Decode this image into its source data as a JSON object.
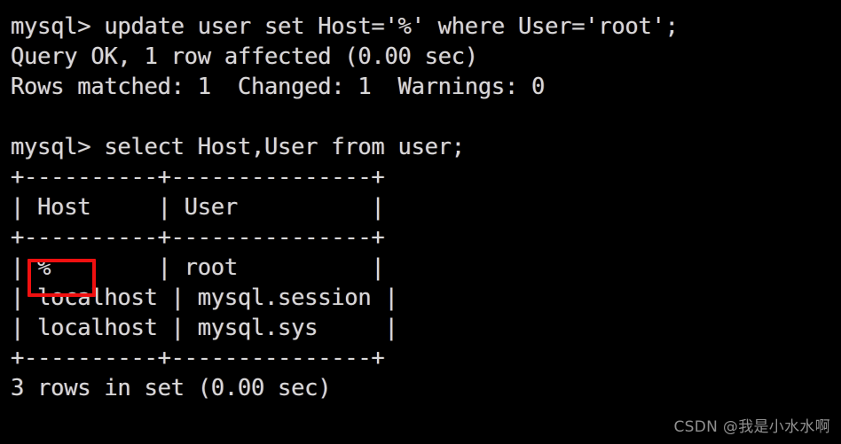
{
  "window": {
    "title": "mysql client terminal",
    "background_color": "#000000",
    "foreground_color": "#d8d8d8"
  },
  "terminal": {
    "prompt": "mysql>",
    "lines": [
      "mysql> update user set Host='%' where User='root';",
      "Query OK, 1 row affected (0.00 sec)",
      "Rows matched: 1  Changed: 1  Warnings: 0",
      "",
      "mysql> select Host,User from user;",
      "+----------+---------------+",
      "| Host     | User          |",
      "+----------+---------------+",
      "| %        | root          |",
      "| localhost | mysql.session |",
      "| localhost | mysql.sys     |",
      "+----------+---------------+",
      "3 rows in set (0.00 sec)",
      ""
    ],
    "commands": [
      "update user set Host='%' where User='root';",
      "select Host,User from user;"
    ],
    "status_messages": [
      "Query OK, 1 row affected (0.00 sec)",
      "Rows matched: 1  Changed: 1  Warnings: 0",
      "3 rows in set (0.00 sec)"
    ],
    "result_table": {
      "columns": [
        "Host",
        "User"
      ],
      "rows": [
        {
          "Host": "%",
          "User": "root"
        },
        {
          "Host": "localhost",
          "User": "mysql.session"
        },
        {
          "Host": "localhost",
          "User": "mysql.sys"
        }
      ],
      "row_count_label": "3 rows in set (0.00 sec)",
      "border_top": "+----------+---------------+",
      "border_header": "+----------+---------------+",
      "border_bottom": "+----------+---------------+"
    }
  },
  "annotation": {
    "highlight_color": "#f01010",
    "highlight_target_value": "%",
    "highlight_target_column": "Host"
  },
  "watermark": {
    "text": "CSDN @我是小水水啊",
    "color": "#b4b4b4"
  }
}
